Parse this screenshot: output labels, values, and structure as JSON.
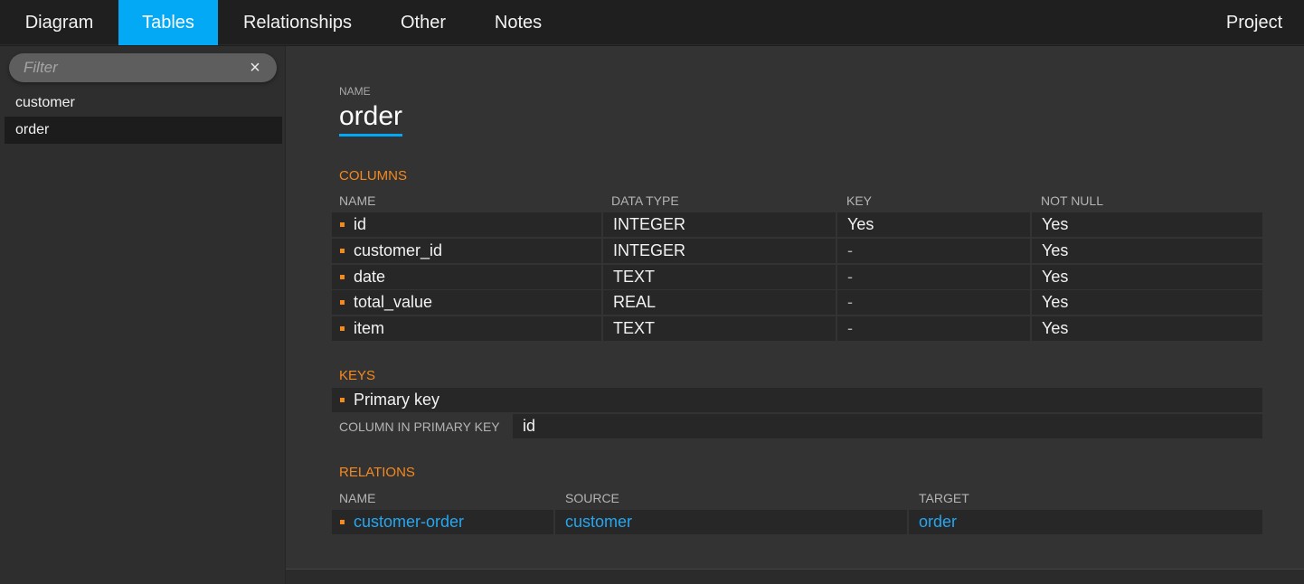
{
  "tabs": {
    "diagram": "Diagram",
    "tables": "Tables",
    "relationships": "Relationships",
    "other": "Other",
    "notes": "Notes",
    "project": "Project"
  },
  "sidebar": {
    "filter_placeholder": "Filter",
    "clear_icon": "×",
    "items": [
      {
        "label": "customer",
        "selected": false
      },
      {
        "label": "order",
        "selected": true
      }
    ]
  },
  "table": {
    "name_label": "NAME",
    "name": "order",
    "columns_title": "COLUMNS",
    "columns_headers": [
      "NAME",
      "DATA TYPE",
      "KEY",
      "NOT NULL"
    ],
    "columns": [
      {
        "name": "id",
        "type": "INTEGER",
        "key": "Yes",
        "not_null": "Yes"
      },
      {
        "name": "customer_id",
        "type": "INTEGER",
        "key": "-",
        "not_null": "Yes"
      },
      {
        "name": "date",
        "type": "TEXT",
        "key": "-",
        "not_null": "Yes"
      },
      {
        "name": "total_value",
        "type": "REAL",
        "key": "-",
        "not_null": "Yes"
      },
      {
        "name": "item",
        "type": "TEXT",
        "key": "-",
        "not_null": "Yes"
      }
    ],
    "keys_title": "KEYS",
    "keys": [
      {
        "name": "Primary key",
        "column_label": "COLUMN IN PRIMARY KEY",
        "column": "id"
      }
    ],
    "relations_title": "RELATIONS",
    "relations_headers": [
      "NAME",
      "SOURCE",
      "TARGET"
    ],
    "relations": [
      {
        "name": "customer-order",
        "source": "customer",
        "target": "order"
      }
    ]
  },
  "colors": {
    "accent": "#03a9f4",
    "section": "#f5891e",
    "link": "#27a6f0"
  }
}
